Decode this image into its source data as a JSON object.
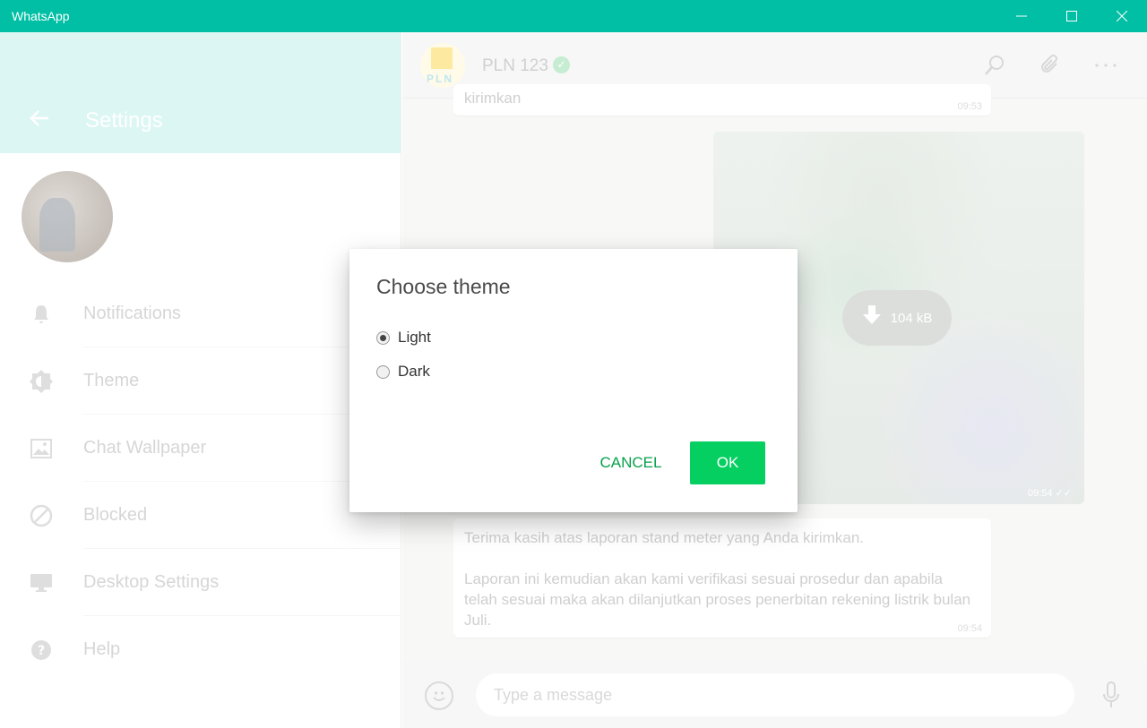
{
  "window": {
    "title": "WhatsApp",
    "controls": [
      "minimize",
      "maximize",
      "close"
    ]
  },
  "settings": {
    "title": "Settings",
    "menu": [
      {
        "label": "Notifications",
        "icon": "bell-icon"
      },
      {
        "label": "Theme",
        "icon": "theme-icon"
      },
      {
        "label": "Chat Wallpaper",
        "icon": "wallpaper-icon"
      },
      {
        "label": "Blocked",
        "icon": "blocked-icon"
      },
      {
        "label": "Desktop Settings",
        "icon": "monitor-icon"
      },
      {
        "label": "Help",
        "icon": "help-icon"
      }
    ]
  },
  "chat": {
    "contact_name": "PLN 123",
    "logo_text": "PLN",
    "messages": [
      {
        "text": "kirimkan",
        "time": "09:53"
      },
      {
        "type": "image",
        "size": "104 kB",
        "time": "09:54"
      },
      {
        "text": "Terima kasih atas laporan stand meter yang Anda kirimkan.\n\nLaporan ini kemudian akan kami verifikasi sesuai prosedur dan apabila telah sesuai maka akan dilanjutkan proses penerbitan rekening listrik bulan Juli.",
        "time": "09:54"
      }
    ],
    "composer": {
      "placeholder": "Type a message"
    }
  },
  "dialog": {
    "title": "Choose theme",
    "options": [
      {
        "label": "Light",
        "checked": true
      },
      {
        "label": "Dark",
        "checked": false
      }
    ],
    "cancel_label": "CANCEL",
    "ok_label": "OK"
  },
  "colors": {
    "accent": "#00bfa5",
    "ok_button": "#06cf62",
    "cancel_text": "#07a14b"
  }
}
